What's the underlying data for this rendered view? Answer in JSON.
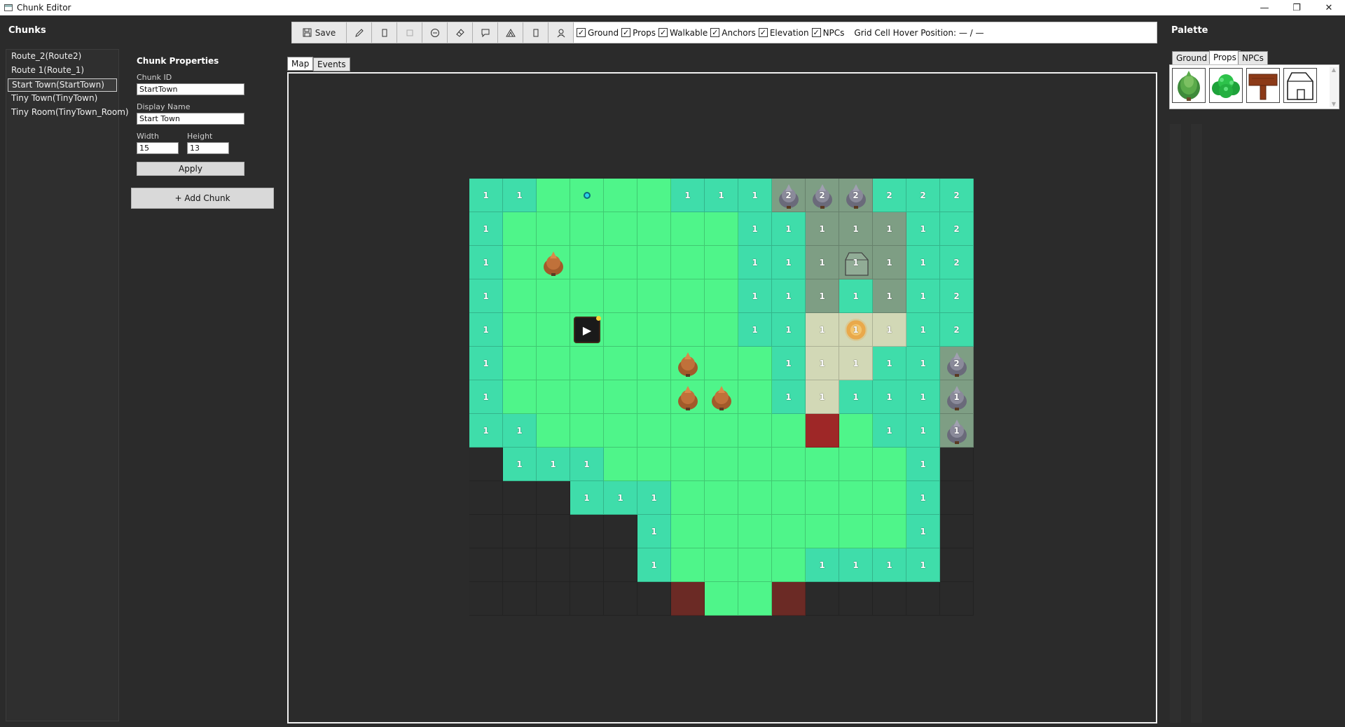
{
  "window": {
    "title": "Chunk Editor",
    "minimize_glyph": "—",
    "maximize_glyph": "❐",
    "close_glyph": "✕"
  },
  "chunks": {
    "title": "Chunks",
    "items": [
      {
        "label": "Route_2(Route2)"
      },
      {
        "label": "Route 1(Route_1)"
      },
      {
        "label": "Start Town(StartTown)"
      },
      {
        "label": "Tiny Town(TinyTown)"
      },
      {
        "label": "Tiny Room(TinyTown_Room)"
      }
    ],
    "selected_index": 2
  },
  "properties": {
    "title": "Chunk Properties",
    "chunk_id_label": "Chunk ID",
    "chunk_id_value": "StartTown",
    "display_name_label": "Display Name",
    "display_name_value": "Start Town",
    "width_label": "Width",
    "width_value": "15",
    "height_label": "Height",
    "height_value": "13",
    "apply_label": "Apply",
    "add_chunk_label": "+ Add Chunk"
  },
  "toolbar": {
    "save_label": "Save",
    "tools": [
      "pencil-icon",
      "rect-icon",
      "rect-outline-icon",
      "erase-circle-icon",
      "eraser-icon",
      "comment-icon",
      "elevation-icon",
      "door-icon",
      "npc-icon"
    ],
    "checkboxes": [
      {
        "label": "Ground",
        "checked": true
      },
      {
        "label": "Props",
        "checked": true
      },
      {
        "label": "Walkable",
        "checked": true
      },
      {
        "label": "Anchors",
        "checked": true
      },
      {
        "label": "Elevation",
        "checked": true
      },
      {
        "label": "NPCs",
        "checked": true
      }
    ],
    "hover_label": "Grid Cell Hover Position: — / —"
  },
  "tabs": [
    {
      "label": "Map",
      "active": true
    },
    {
      "label": "Events",
      "active": false
    }
  ],
  "map": {
    "columns": 15,
    "rows": 13,
    "colors": {
      "grass": "#4ff58a",
      "teal": "#3fddaa",
      "void": "#2a2a2a",
      "stone": "#7e9e84",
      "sand": "#d2d8b6",
      "red": "#9e2727",
      "maroon": "#6b2a25"
    },
    "tiles": [
      "ttgggg tttsssttt",
      "tggggggttsssttt"
    ],
    "grid": [
      [
        "t",
        "t",
        "g",
        "g",
        "g",
        "g",
        "t",
        "t",
        "t",
        "s",
        "s",
        "s",
        "t",
        "t",
        "t"
      ],
      [
        "t",
        "g",
        "g",
        "g",
        "g",
        "g",
        "g",
        "g",
        "t",
        "t",
        "s",
        "s",
        "s",
        "t",
        "t"
      ],
      [
        "t",
        "g",
        "g",
        "g",
        "g",
        "g",
        "g",
        "g",
        "t",
        "t",
        "s",
        "s",
        "s",
        "t",
        "t"
      ],
      [
        "t",
        "g",
        "g",
        "g",
        "g",
        "g",
        "g",
        "g",
        "t",
        "t",
        "s",
        "t",
        "s",
        "t",
        "t"
      ],
      [
        "t",
        "g",
        "g",
        "g",
        "g",
        "g",
        "g",
        "g",
        "t",
        "t",
        "b",
        "b",
        "b",
        "t",
        "t"
      ],
      [
        "t",
        "g",
        "g",
        "g",
        "g",
        "g",
        "g",
        "g",
        "g",
        "t",
        "b",
        "b",
        "t",
        "t",
        "s"
      ],
      [
        "t",
        "g",
        "g",
        "g",
        "g",
        "g",
        "g",
        "g",
        "g",
        "t",
        "b",
        "t",
        "t",
        "t",
        "s"
      ],
      [
        "t",
        "t",
        "g",
        "g",
        "g",
        "g",
        "g",
        "g",
        "g",
        "g",
        "r",
        "g",
        "t",
        "t",
        "s"
      ],
      [
        "d",
        "t",
        "t",
        "t",
        "g",
        "g",
        "g",
        "g",
        "g",
        "g",
        "g",
        "g",
        "g",
        "t",
        "d"
      ],
      [
        "d",
        "d",
        "d",
        "t",
        "t",
        "t",
        "g",
        "g",
        "g",
        "g",
        "g",
        "g",
        "g",
        "t",
        "d"
      ],
      [
        "d",
        "d",
        "d",
        "d",
        "d",
        "t",
        "g",
        "g",
        "g",
        "g",
        "g",
        "g",
        "g",
        "t",
        "d"
      ],
      [
        "d",
        "d",
        "d",
        "d",
        "d",
        "t",
        "g",
        "g",
        "g",
        "g",
        "t",
        "t",
        "t",
        "t",
        "d"
      ],
      [
        "d",
        "d",
        "d",
        "d",
        "d",
        "d",
        "m",
        "g",
        "g",
        "m",
        "d",
        "d",
        "d",
        "d",
        "d"
      ]
    ],
    "numbers": [
      [
        "1",
        "1",
        "",
        "",
        "",
        "",
        "1",
        "1",
        "1",
        "2",
        "2",
        "2",
        "2",
        "2",
        "2"
      ],
      [
        "1",
        "",
        "",
        "",
        "",
        "",
        "",
        "",
        "1",
        "1",
        "1",
        "1",
        "1",
        "1",
        "2"
      ],
      [
        "1",
        "",
        "",
        "",
        "",
        "",
        "",
        "",
        "1",
        "1",
        "1",
        "1",
        "1",
        "1",
        "2"
      ],
      [
        "1",
        "",
        "",
        "",
        "",
        "",
        "",
        "",
        "1",
        "1",
        "1",
        "1",
        "1",
        "1",
        "2"
      ],
      [
        "1",
        "",
        "",
        "",
        "",
        "",
        "",
        "",
        "1",
        "1",
        "1",
        "1",
        "1",
        "1",
        "2"
      ],
      [
        "1",
        "",
        "",
        "",
        "",
        "",
        "",
        "",
        "",
        "1",
        "1",
        "1",
        "1",
        "1",
        "2"
      ],
      [
        "1",
        "",
        "",
        "",
        "",
        "",
        "",
        "",
        "",
        "1",
        "1",
        "1",
        "1",
        "1",
        "1"
      ],
      [
        "1",
        "1",
        "",
        "",
        "",
        "",
        "",
        "",
        "",
        "",
        "",
        "",
        "1",
        "1",
        "1"
      ],
      [
        "",
        "1",
        "1",
        "1",
        "",
        "",
        "",
        "",
        "",
        "",
        "",
        "",
        "",
        "1",
        ""
      ],
      [
        "",
        "",
        "",
        "1",
        "1",
        "1",
        "",
        "",
        "",
        "",
        "",
        "",
        "",
        "1",
        ""
      ],
      [
        "",
        "",
        "",
        "",
        "",
        "1",
        "",
        "",
        "",
        "",
        "",
        "",
        "",
        "1",
        ""
      ],
      [
        "",
        "",
        "",
        "",
        "",
        "1",
        "",
        "",
        "",
        "",
        "1",
        "1",
        "1",
        "1",
        ""
      ],
      [
        "",
        "",
        "",
        "",
        "",
        "",
        "",
        "",
        "",
        "",
        "",
        "",
        "",
        "",
        ""
      ]
    ],
    "trees_brown": [
      [
        2,
        2
      ],
      [
        5,
        6
      ],
      [
        6,
        6
      ],
      [
        6,
        7
      ]
    ],
    "trees_gray": [
      [
        0,
        9
      ],
      [
        0,
        10
      ],
      [
        0,
        11
      ],
      [
        5,
        14
      ],
      [
        6,
        14
      ],
      [
        7,
        14
      ]
    ],
    "house": [
      2,
      11
    ],
    "ring": [
      4,
      11
    ],
    "anchor": [
      0,
      3
    ],
    "npc": [
      4,
      3
    ]
  },
  "palette": {
    "title": "Palette",
    "tabs": [
      {
        "label": "Ground",
        "active": false
      },
      {
        "label": "Props",
        "active": true
      },
      {
        "label": "NPCs",
        "active": false
      }
    ],
    "items": [
      "tree-icon",
      "bush-icon",
      "signpost-icon",
      "house-icon"
    ]
  }
}
